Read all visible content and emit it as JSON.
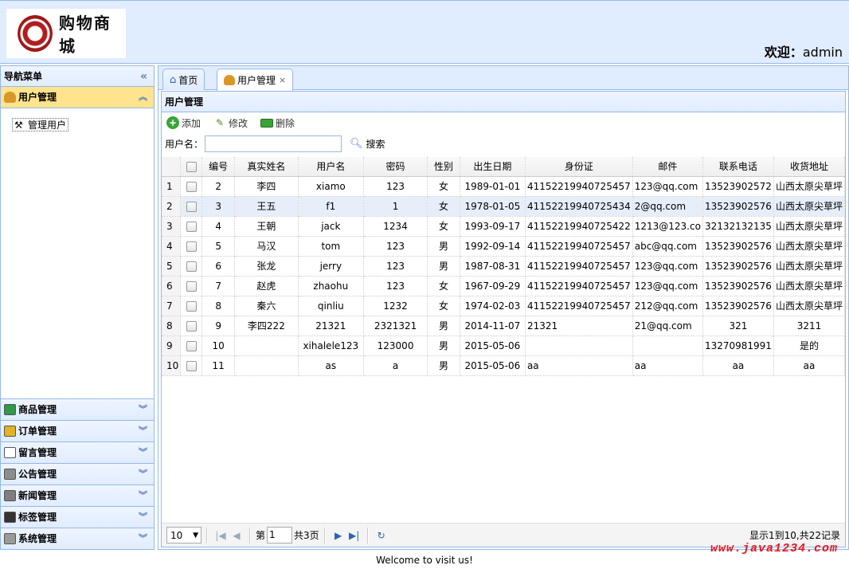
{
  "header": {
    "logo_text": "购物商城",
    "welcome_label": "欢迎：",
    "welcome_user": "admin"
  },
  "nav": {
    "title": "导航菜单",
    "collapse_glyph": "«",
    "active_section": {
      "label": "用户管理",
      "chevron": "︽",
      "items": [
        "管理用户"
      ]
    },
    "sections": [
      {
        "label": "商品管理",
        "icon_color": "#2e9a4a",
        "chevron": "︾"
      },
      {
        "label": "订单管理",
        "icon_color": "#e0b422",
        "chevron": "︾"
      },
      {
        "label": "留言管理",
        "icon_color": "#ffffff",
        "chevron": "︾"
      },
      {
        "label": "公告管理",
        "icon_color": "#8c8c8c",
        "chevron": "︾"
      },
      {
        "label": "新闻管理",
        "icon_color": "#7f7f7f",
        "chevron": "︾"
      },
      {
        "label": "标签管理",
        "icon_color": "#333333",
        "chevron": "︾"
      },
      {
        "label": "系统管理",
        "icon_color": "#9a9a9a",
        "chevron": "︾"
      }
    ]
  },
  "tabs": [
    {
      "label": "首页",
      "icon": "home-icon",
      "closable": false
    },
    {
      "label": "用户管理",
      "icon": "user-icon",
      "closable": true,
      "close_glyph": "×"
    }
  ],
  "panel": {
    "title": "用户管理",
    "toolbar": {
      "add": "添加",
      "edit": "修改",
      "delete": "删除"
    },
    "search": {
      "label": "用户名：",
      "value": "",
      "button": "搜索"
    }
  },
  "grid": {
    "columns": [
      "编号",
      "真实姓名",
      "用户名",
      "密码",
      "性别",
      "出生日期",
      "身份证",
      "邮件",
      "联系电话",
      "收货地址"
    ],
    "rows": [
      {
        "rn": "1",
        "cells": [
          "2",
          "李四",
          "xiamo",
          "123",
          "女",
          "1989-01-01",
          "41152219940725457",
          "123@qq.com",
          "13523902572",
          "山西太原尖草坪"
        ]
      },
      {
        "rn": "2",
        "cells": [
          "3",
          "王五",
          "f1",
          "1",
          "女",
          "1978-01-05",
          "41152219940725434",
          "2@qq.com",
          "13523902576",
          "山西太原尖草坪"
        ]
      },
      {
        "rn": "3",
        "cells": [
          "4",
          "王朝",
          "jack",
          "1234",
          "女",
          "1993-09-17",
          "41152219940725422",
          "1213@123.co",
          "32132132135",
          "山西太原尖草坪"
        ]
      },
      {
        "rn": "4",
        "cells": [
          "5",
          "马汉",
          "tom",
          "123",
          "男",
          "1992-09-14",
          "41152219940725457",
          "abc@qq.com",
          "13523902576",
          "山西太原尖草坪"
        ]
      },
      {
        "rn": "5",
        "cells": [
          "6",
          "张龙",
          "jerry",
          "123",
          "男",
          "1987-08-31",
          "41152219940725457",
          "123@qq.com",
          "13523902576",
          "山西太原尖草坪"
        ]
      },
      {
        "rn": "6",
        "cells": [
          "7",
          "赵虎",
          "zhaohu",
          "123",
          "女",
          "1967-09-29",
          "41152219940725457",
          "123@qq.com",
          "13523902576",
          "山西太原尖草坪"
        ]
      },
      {
        "rn": "7",
        "cells": [
          "8",
          "秦六",
          "qinliu",
          "1232",
          "女",
          "1974-02-03",
          "41152219940725457",
          "212@qq.com",
          "13523902576",
          "山西太原尖草坪"
        ]
      },
      {
        "rn": "8",
        "cells": [
          "9",
          "李四222",
          "21321",
          "2321321",
          "男",
          "2014-11-07",
          "21321",
          "21@qq.com",
          "321",
          "3211"
        ]
      },
      {
        "rn": "9",
        "cells": [
          "10",
          "",
          "xihalele123",
          "123000",
          "男",
          "2015-05-06",
          "",
          "",
          "13270981991",
          "是的"
        ]
      },
      {
        "rn": "10",
        "cells": [
          "11",
          "",
          "as",
          "a",
          "男",
          "2015-05-06",
          "aa",
          "aa",
          "aa",
          "aa"
        ]
      }
    ],
    "highlighted_row": 1
  },
  "pager": {
    "page_size": "10",
    "page_prefix": "第",
    "page_value": "1",
    "page_suffix": "共3页",
    "info": "显示1到10,共22记录"
  },
  "footer": {
    "text": "Welcome to visit us!"
  },
  "watermark": "www.java1234.com"
}
